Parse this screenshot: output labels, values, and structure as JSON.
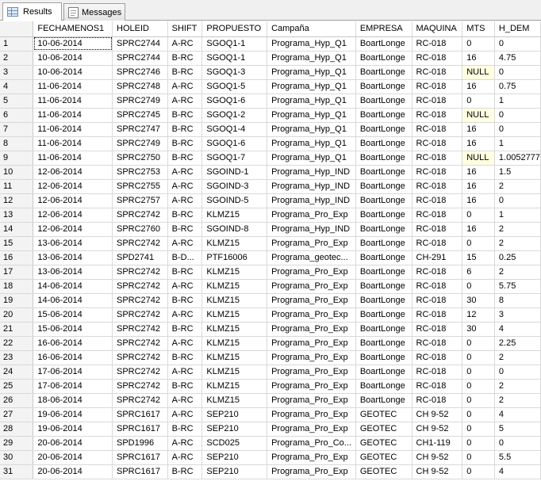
{
  "tabs": [
    {
      "label": "Results",
      "icon": "grid-icon",
      "active": true
    },
    {
      "label": "Messages",
      "icon": "messages-icon",
      "active": false
    }
  ],
  "grid": {
    "columns": [
      "",
      "FECHAMENOS1",
      "HOLEID",
      "SHIFT",
      "PROPUESTO",
      "Campaña",
      "EMPRESA",
      "MAQUINA",
      "MTS",
      "H_DEM"
    ],
    "rows": [
      [
        "1",
        "10-06-2014",
        "SPRC2744",
        "A-RC",
        "SGOQ1-1",
        "Programa_Hyp_Q1",
        "BoartLonge",
        "RC-018",
        "0",
        "0"
      ],
      [
        "2",
        "10-06-2014",
        "SPRC2744",
        "B-RC",
        "SGOQ1-1",
        "Programa_Hyp_Q1",
        "BoartLonge",
        "RC-018",
        "16",
        "4.75"
      ],
      [
        "3",
        "10-06-2014",
        "SPRC2746",
        "B-RC",
        "SGOQ1-3",
        "Programa_Hyp_Q1",
        "BoartLonge",
        "RC-018",
        "NULL",
        "0"
      ],
      [
        "4",
        "11-06-2014",
        "SPRC2748",
        "A-RC",
        "SGOQ1-5",
        "Programa_Hyp_Q1",
        "BoartLonge",
        "RC-018",
        "16",
        "0.75"
      ],
      [
        "5",
        "11-06-2014",
        "SPRC2749",
        "A-RC",
        "SGOQ1-6",
        "Programa_Hyp_Q1",
        "BoartLonge",
        "RC-018",
        "0",
        "1"
      ],
      [
        "6",
        "11-06-2014",
        "SPRC2745",
        "B-RC",
        "SGOQ1-2",
        "Programa_Hyp_Q1",
        "BoartLonge",
        "RC-018",
        "NULL",
        "0"
      ],
      [
        "7",
        "11-06-2014",
        "SPRC2747",
        "B-RC",
        "SGOQ1-4",
        "Programa_Hyp_Q1",
        "BoartLonge",
        "RC-018",
        "16",
        "0"
      ],
      [
        "8",
        "11-06-2014",
        "SPRC2749",
        "B-RC",
        "SGOQ1-6",
        "Programa_Hyp_Q1",
        "BoartLonge",
        "RC-018",
        "16",
        "1"
      ],
      [
        "9",
        "11-06-2014",
        "SPRC2750",
        "B-RC",
        "SGOQ1-7",
        "Programa_Hyp_Q1",
        "BoartLonge",
        "RC-018",
        "NULL",
        "1.0052777"
      ],
      [
        "10",
        "12-06-2014",
        "SPRC2753",
        "A-RC",
        "SGOIND-1",
        "Programa_Hyp_IND",
        "BoartLonge",
        "RC-018",
        "16",
        "1.5"
      ],
      [
        "11",
        "12-06-2014",
        "SPRC2755",
        "A-RC",
        "SGOIND-3",
        "Programa_Hyp_IND",
        "BoartLonge",
        "RC-018",
        "16",
        "2"
      ],
      [
        "12",
        "12-06-2014",
        "SPRC2757",
        "A-RC",
        "SGOIND-5",
        "Programa_Hyp_IND",
        "BoartLonge",
        "RC-018",
        "16",
        "0"
      ],
      [
        "13",
        "12-06-2014",
        "SPRC2742",
        "B-RC",
        "KLMZ15",
        "Programa_Pro_Exp",
        "BoartLonge",
        "RC-018",
        "0",
        "1"
      ],
      [
        "14",
        "12-06-2014",
        "SPRC2760",
        "B-RC",
        "SGOIND-8",
        "Programa_Hyp_IND",
        "BoartLonge",
        "RC-018",
        "16",
        "2"
      ],
      [
        "15",
        "13-06-2014",
        "SPRC2742",
        "A-RC",
        "KLMZ15",
        "Programa_Pro_Exp",
        "BoartLonge",
        "RC-018",
        "0",
        "2"
      ],
      [
        "16",
        "13-06-2014",
        "SPD2741",
        "B-D...",
        "PTF16006",
        "Programa_geotec...",
        "BoartLonge",
        "CH-291",
        "15",
        "0.25"
      ],
      [
        "17",
        "13-06-2014",
        "SPRC2742",
        "B-RC",
        "KLMZ15",
        "Programa_Pro_Exp",
        "BoartLonge",
        "RC-018",
        "6",
        "2"
      ],
      [
        "18",
        "14-06-2014",
        "SPRC2742",
        "A-RC",
        "KLMZ15",
        "Programa_Pro_Exp",
        "BoartLonge",
        "RC-018",
        "0",
        "5.75"
      ],
      [
        "19",
        "14-06-2014",
        "SPRC2742",
        "B-RC",
        "KLMZ15",
        "Programa_Pro_Exp",
        "BoartLonge",
        "RC-018",
        "30",
        "8"
      ],
      [
        "20",
        "15-06-2014",
        "SPRC2742",
        "A-RC",
        "KLMZ15",
        "Programa_Pro_Exp",
        "BoartLonge",
        "RC-018",
        "12",
        "3"
      ],
      [
        "21",
        "15-06-2014",
        "SPRC2742",
        "B-RC",
        "KLMZ15",
        "Programa_Pro_Exp",
        "BoartLonge",
        "RC-018",
        "30",
        "4"
      ],
      [
        "22",
        "16-06-2014",
        "SPRC2742",
        "A-RC",
        "KLMZ15",
        "Programa_Pro_Exp",
        "BoartLonge",
        "RC-018",
        "0",
        "2.25"
      ],
      [
        "23",
        "16-06-2014",
        "SPRC2742",
        "B-RC",
        "KLMZ15",
        "Programa_Pro_Exp",
        "BoartLonge",
        "RC-018",
        "0",
        "2"
      ],
      [
        "24",
        "17-06-2014",
        "SPRC2742",
        "A-RC",
        "KLMZ15",
        "Programa_Pro_Exp",
        "BoartLonge",
        "RC-018",
        "0",
        "0"
      ],
      [
        "25",
        "17-06-2014",
        "SPRC2742",
        "B-RC",
        "KLMZ15",
        "Programa_Pro_Exp",
        "BoartLonge",
        "RC-018",
        "0",
        "2"
      ],
      [
        "26",
        "18-06-2014",
        "SPRC2742",
        "A-RC",
        "KLMZ15",
        "Programa_Pro_Exp",
        "BoartLonge",
        "RC-018",
        "0",
        "2"
      ],
      [
        "27",
        "19-06-2014",
        "SPRC1617",
        "A-RC",
        "SEP210",
        "Programa_Pro_Exp",
        "GEOTEC",
        "CH 9-52",
        "0",
        "4"
      ],
      [
        "28",
        "19-06-2014",
        "SPRC1617",
        "B-RC",
        "SEP210",
        "Programa_Pro_Exp",
        "GEOTEC",
        "CH 9-52",
        "0",
        "5"
      ],
      [
        "29",
        "20-06-2014",
        "SPD1996",
        "A-RC",
        "SCD025",
        "Programa_Pro_Co...",
        "GEOTEC",
        "CH1-119",
        "0",
        "0"
      ],
      [
        "30",
        "20-06-2014",
        "SPRC1617",
        "A-RC",
        "SEP210",
        "Programa_Pro_Exp",
        "GEOTEC",
        "CH 9-52",
        "0",
        "5.5"
      ],
      [
        "31",
        "20-06-2014",
        "SPRC1617",
        "B-RC",
        "SEP210",
        "Programa_Pro_Exp",
        "GEOTEC",
        "CH 9-52",
        "0",
        "4"
      ]
    ],
    "null_cell_color": "#ffffe1"
  }
}
